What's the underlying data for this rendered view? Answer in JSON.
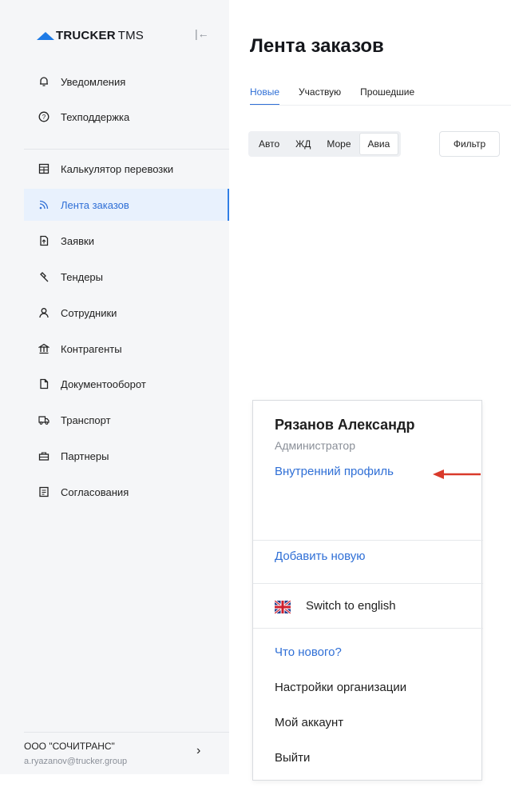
{
  "brand": {
    "name": "TRUCKER",
    "suffix": "TMS",
    "accent": "#1e7be6"
  },
  "sidebar": {
    "collapse_icon": "collapse-left-icon",
    "top_items": [
      {
        "label": "Уведомления",
        "icon": "bell-icon"
      },
      {
        "label": "Техподдержка",
        "icon": "help-circle-icon"
      }
    ],
    "items": [
      {
        "label": "Калькулятор перевозки",
        "icon": "calculator-icon"
      },
      {
        "label": "Лента заказов",
        "icon": "feed-icon",
        "active": true
      },
      {
        "label": "Заявки",
        "icon": "request-icon"
      },
      {
        "label": "Тендеры",
        "icon": "hammer-icon"
      },
      {
        "label": "Сотрудники",
        "icon": "user-icon"
      },
      {
        "label": "Контрагенты",
        "icon": "bank-icon"
      },
      {
        "label": "Документооборот",
        "icon": "document-icon"
      },
      {
        "label": "Транспорт",
        "icon": "truck-icon"
      },
      {
        "label": "Партнеры",
        "icon": "handshake-icon"
      },
      {
        "label": "Согласования",
        "icon": "approval-icon"
      }
    ],
    "footer": {
      "org": "ООО \"СОЧИТРАНС\"",
      "email": "a.ryazanov@trucker.group"
    }
  },
  "main": {
    "title": "Лента заказов",
    "tabs": [
      {
        "label": "Новые",
        "active": true
      },
      {
        "label": "Участвую"
      },
      {
        "label": "Прошедшие"
      }
    ],
    "transport_modes": [
      "Авто",
      "ЖД",
      "Море",
      "Авиа"
    ],
    "selected_mode": "Авиа",
    "filter_label": "Фильтр"
  },
  "menu": {
    "user_name": "Рязанов Александр",
    "user_role": "Администратор",
    "internal_profile": "Внутренний профиль",
    "add_new": "Добавить новую",
    "switch_language": "Switch to english",
    "whats_new": "Что нового?",
    "org_settings": "Настройки организации",
    "my_account": "Мой аккаунт",
    "logout": "Выйти",
    "link_color": "#2f6fd6",
    "annotation_arrow_color": "#d93a2b"
  }
}
